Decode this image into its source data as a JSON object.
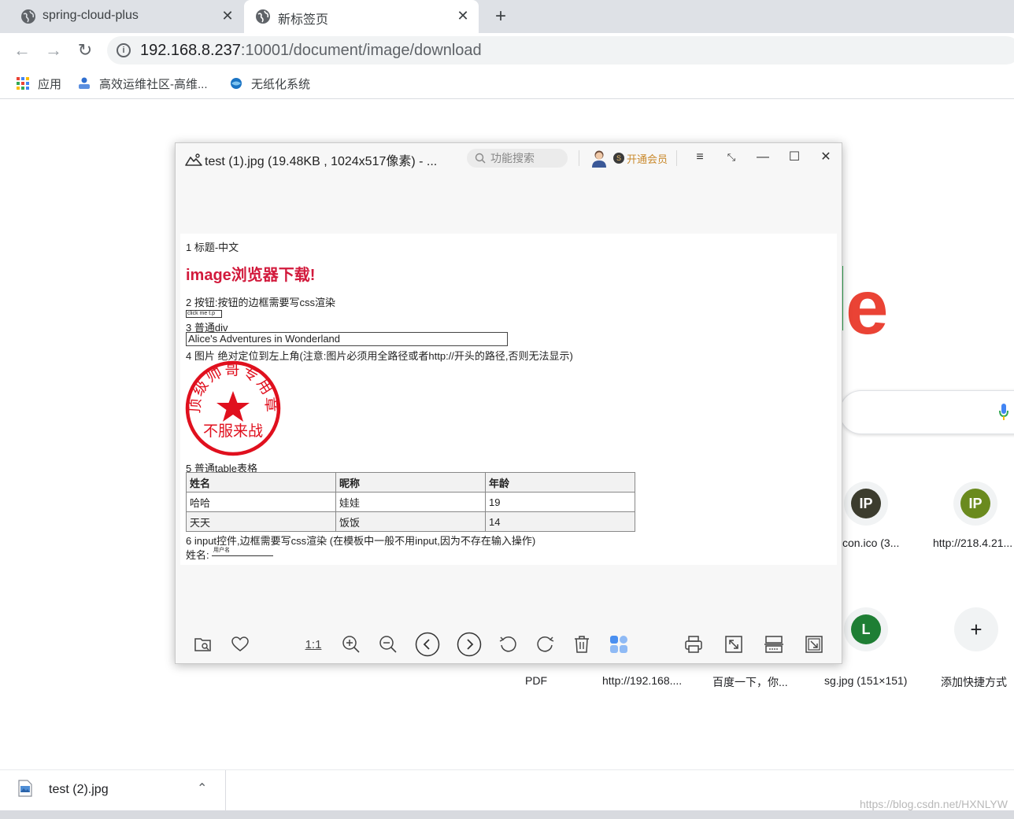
{
  "browser": {
    "tabs": [
      {
        "title": "spring-cloud-plus",
        "active": false
      },
      {
        "title": "新标签页",
        "active": true
      }
    ],
    "url_host": "192.168.8.237",
    "url_rest": ":10001/document/image/download",
    "bookmarks": [
      {
        "label": "应用",
        "icon": "apps-grid-icon"
      },
      {
        "label": "高效运维社区-高维...",
        "icon": "site-favicon"
      },
      {
        "label": "无纸化系统",
        "icon": "site-favicon"
      }
    ]
  },
  "new_tab_page": {
    "logo_fragment": "e",
    "shortcuts": [
      {
        "initials": "IP",
        "label": "con.ico (3...",
        "color": "#3c3c2e"
      },
      {
        "initials": "IP",
        "label": "http://218.4.21...",
        "color": "#6a8a1e"
      },
      {
        "initials": "L",
        "label": "",
        "color": "#1e7e34"
      },
      {
        "initials": "+",
        "label": "",
        "color": "#f1f3f4"
      }
    ],
    "bottom_labels": [
      "PDF",
      "http://192.168....",
      "百度一下，你...",
      "sg.jpg (151×151)",
      "添加快捷方式"
    ]
  },
  "viewer": {
    "title": "test (1).jpg (19.48KB , 1024x517像素) - ...",
    "search_placeholder": "功能搜索",
    "member_label": "开通会员",
    "toolbar": [
      "open-folder-icon",
      "favorite-icon",
      "actual-size-icon",
      "zoom-in-icon",
      "zoom-out-icon",
      "previous-icon",
      "next-icon",
      "rotate-left-icon",
      "rotate-right-icon",
      "delete-icon",
      "apps-icon",
      "print-icon",
      "fit-window-icon",
      "scan-icon",
      "fullscreen-icon"
    ],
    "actual_size_label": "1:1"
  },
  "document": {
    "section1": "1 标题-中文",
    "heading": "image浏览器下载!",
    "section2": "2 按钮:按钮的边框需要写css渲染",
    "button_text": "click me t.p",
    "section3": "3 普通div",
    "div_text": "Alice's Adventures in Wonderland",
    "section4": "4 图片 绝对定位到左上角(注意:图片必须用全路径或者http://开头的路径,否则无法显示)",
    "seal_top": "顶级帅哥专用章",
    "seal_bottom": "不服来战",
    "section5": "5 普通table表格",
    "table_headers": [
      "姓名",
      "昵称",
      "年龄"
    ],
    "table_rows": [
      [
        "哈哈",
        "娃娃",
        "19"
      ],
      [
        "天天",
        "饭饭",
        "14"
      ]
    ],
    "section6": "6 input控件,边框需要写css渲染 (在模板中一般不用input,因为不存在输入操作)",
    "input_label": "姓名:",
    "input_value": "用户名"
  },
  "downloads": {
    "file_name": "test (2).jpg"
  },
  "watermark": "https://blog.csdn.net/HXNLYW",
  "colors": {
    "heading_red": "#d21a3c",
    "seal_red": "#e0101e",
    "member_gold": "#c9892c"
  }
}
